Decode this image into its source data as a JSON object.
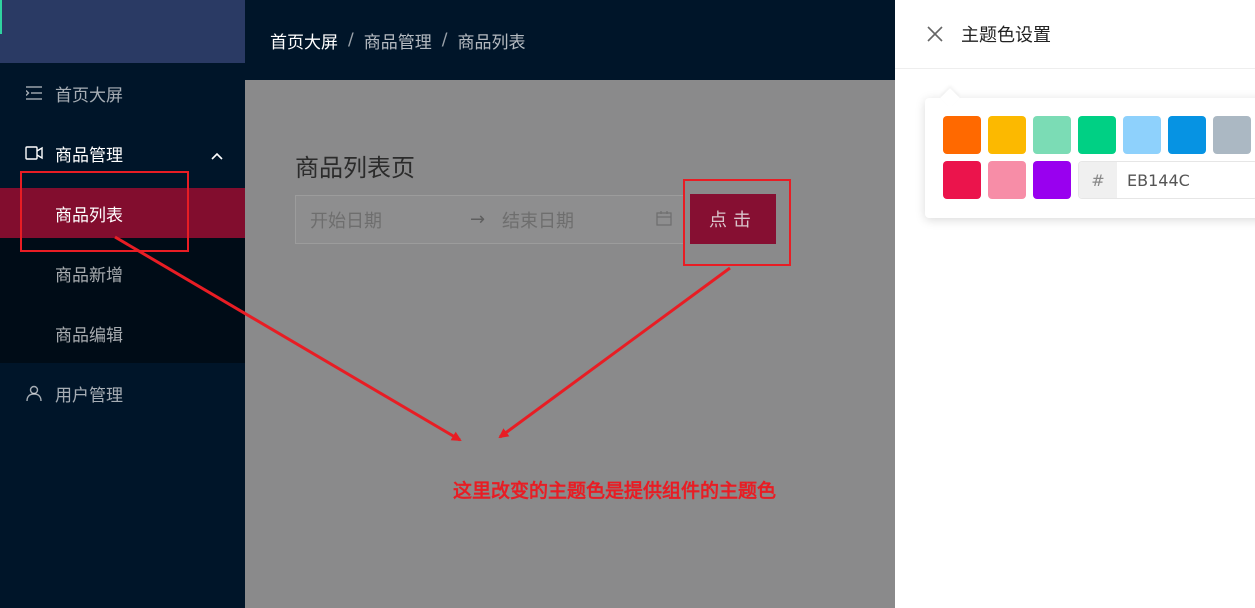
{
  "sidebar": {
    "items": [
      {
        "label": "首页大屏",
        "icon": "menu-list-icon"
      },
      {
        "label": "商品管理",
        "icon": "video-icon",
        "children": [
          {
            "label": "商品列表"
          },
          {
            "label": "商品新增"
          },
          {
            "label": "商品编辑"
          }
        ]
      },
      {
        "label": "用户管理",
        "icon": "user-icon"
      }
    ]
  },
  "breadcrumb": [
    "首页大屏",
    "商品管理",
    "商品列表"
  ],
  "breadcrumb_separator": "/",
  "main": {
    "title": "商品列表页",
    "date_start_placeholder": "开始日期",
    "date_end_placeholder": "结束日期",
    "range_separator": "→",
    "button_label": "点击"
  },
  "annotation": {
    "text": "这里改变的主题色是提供组件的主题色",
    "color": "#E81D24"
  },
  "drawer": {
    "title": "主题色设置",
    "hex_prefix": "#",
    "hex_value": "EB144C",
    "swatches_row1": [
      "#FF6900",
      "#FCB900",
      "#7BDCB5",
      "#00D084",
      "#8ED1FC",
      "#0693E3",
      "#ABB8C3"
    ],
    "swatches_row2": [
      "#EB144C",
      "#F78DA7",
      "#9900EF"
    ]
  },
  "colors": {
    "sidebar_bg": "#001529",
    "active_menu": "#820D2E",
    "primary": "#EB144C"
  }
}
